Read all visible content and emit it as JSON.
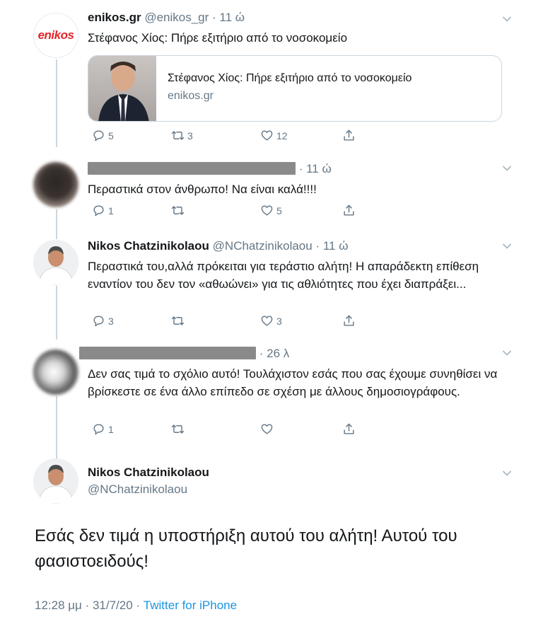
{
  "colors": {
    "text": "#14171a",
    "meta": "#657786",
    "link": "#1b95e0",
    "thread": "#ccd6dd"
  },
  "tweets": [
    {
      "name": "enikos.gr",
      "handle": "@enikos_gr",
      "time": "· 11 ώ",
      "text": "Στέφανος Χίος: Πήρε εξιτήριο από το νοσοκομείο",
      "avatar_logo": "enikos",
      "card": {
        "title": "Στέφανος Χίος: Πήρε εξιτήριο από το νοσοκομείο",
        "domain": "enikos.gr"
      },
      "replies": "5",
      "retweets": "3",
      "likes": "12"
    },
    {
      "time": "· 11 ώ",
      "text": "Περαστικά στον άνθρωπο! Να είναι καλά!!!!",
      "replies": "1",
      "retweets": "",
      "likes": "5"
    },
    {
      "name": "Nikos Chatzinikolaou",
      "handle": "@NChatzinikolaou",
      "time": "· 11 ώ",
      "text": "Περαστικά του,αλλά πρόκειται για τεράστιο αλήτη! Η απαράδεκτη επίθεση εναντίον του δεν τον «αθωώνει» για τις αθλιότητες που έχει διαπράξει...",
      "replies": "3",
      "retweets": "",
      "likes": "3"
    },
    {
      "time": "· 26 λ",
      "text": "Δεν σας τιμά το σχόλιο αυτό! Τουλάχιστον εσάς που σας έχουμε συνηθίσει να βρίσκεστε σε ένα άλλο επίπεδο σε σχέση με άλλους δημοσιογράφους.",
      "replies": "1",
      "retweets": "",
      "likes": ""
    }
  ],
  "main": {
    "name": "Nikos Chatzinikolaou",
    "handle": "@NChatzinikolaou",
    "text": "Εσάς δεν τιμά η υποστήριξη αυτού του αλήτη! Αυτού του φασιστοειδούς!",
    "timestamp": "12:28 μμ · 31/7/20 · ",
    "source": "Twitter for iPhone"
  }
}
